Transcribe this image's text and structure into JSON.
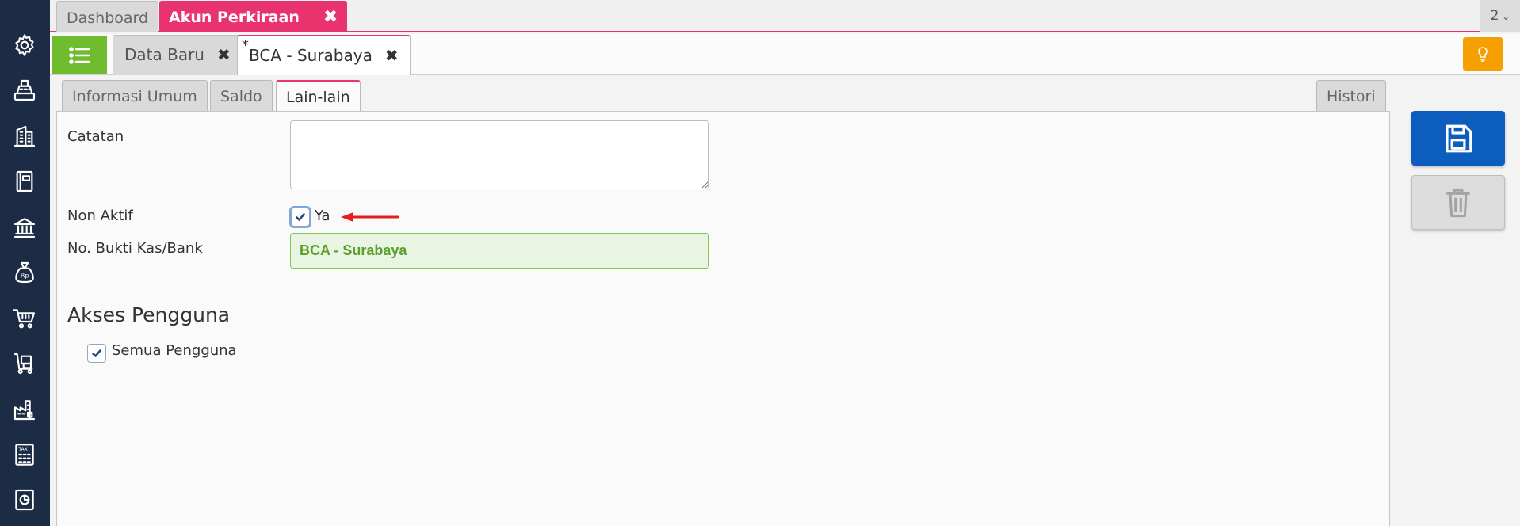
{
  "top_tabs": [
    {
      "label": "Dashboard",
      "active": false
    },
    {
      "label": "Akun Perkiraan",
      "active": true,
      "close": "✖"
    }
  ],
  "page_count": "2",
  "sub_tabs": [
    {
      "label": "Data Baru",
      "close": "✖"
    },
    {
      "label": "BCA - Surabaya",
      "modified_mark": "*",
      "close": "✖",
      "active": true
    }
  ],
  "inner_tabs": {
    "informasi_umum": "Informasi Umum",
    "saldo": "Saldo",
    "lain_lain": "Lain-lain",
    "histori": "Histori"
  },
  "form": {
    "catatan_label": "Catatan",
    "catatan_value": "",
    "non_aktif_label": "Non Aktif",
    "non_aktif_option": "Ya",
    "non_aktif_checked": true,
    "bukti_label": "No. Bukti Kas/Bank",
    "bukti_value": "BCA - Surabaya"
  },
  "akses": {
    "title": "Akses Pengguna",
    "semua_label": "Semua Pengguna",
    "semua_checked": true
  },
  "sidebar_icons": [
    "gear-icon",
    "cash-register-icon",
    "building-icon",
    "book-icon",
    "bank-icon",
    "money-bag-icon",
    "cart-icon",
    "delivery-icon",
    "factory-icon",
    "tax-icon",
    "report-icon"
  ],
  "colors": {
    "sidebar": "#1d2c45",
    "accent_tab": "#e8336f",
    "menu_button": "#6fbd2f",
    "hint_button": "#f5a000",
    "save_button": "#0d5dbf",
    "readonly_field": "#e9f5e2"
  }
}
